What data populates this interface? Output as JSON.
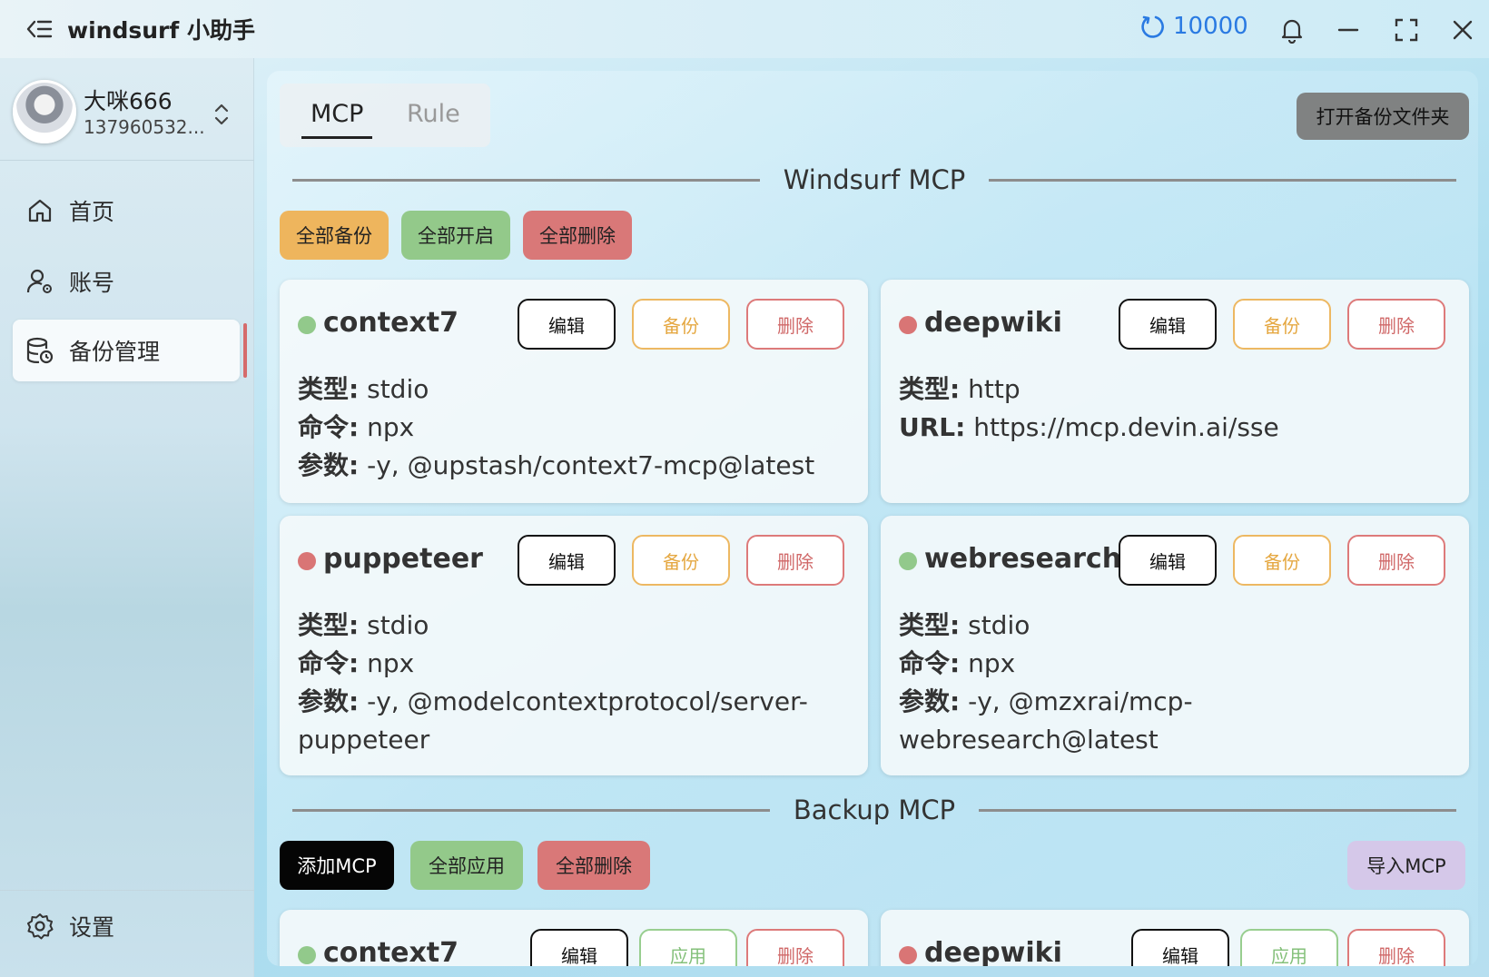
{
  "window": {
    "title": "windsurf 小助手",
    "credits": "10000"
  },
  "user": {
    "name": "大咪666",
    "id": "137960532..."
  },
  "sidebar": {
    "items": [
      {
        "label": "首页",
        "icon": "home-icon"
      },
      {
        "label": "账号",
        "icon": "user-gear-icon"
      },
      {
        "label": "备份管理",
        "icon": "database-backup-icon",
        "active": true
      }
    ],
    "settings_label": "设置"
  },
  "tabs": [
    "MCP",
    "Rule"
  ],
  "active_tab": "MCP",
  "open_backup_folder": "打开备份文件夹",
  "windsurf_section": {
    "title": "Windsurf MCP",
    "actions": [
      "全部备份",
      "全部开启",
      "全部删除"
    ],
    "cards": [
      {
        "name": "context7",
        "status": "green",
        "buttons": [
          "编辑",
          "备份",
          "删除"
        ],
        "lines": [
          {
            "label": "类型:",
            "value": "stdio"
          },
          {
            "label": "命令:",
            "value": "npx"
          },
          {
            "label": "参数:",
            "value": "-y, @upstash/context7-mcp@latest"
          }
        ]
      },
      {
        "name": "deepwiki",
        "status": "red",
        "buttons": [
          "编辑",
          "备份",
          "删除"
        ],
        "lines": [
          {
            "label": "类型:",
            "value": "http"
          },
          {
            "label": "URL:",
            "value": "https://mcp.devin.ai/sse"
          }
        ]
      },
      {
        "name": "puppeteer",
        "status": "red",
        "buttons": [
          "编辑",
          "备份",
          "删除"
        ],
        "lines": [
          {
            "label": "类型:",
            "value": "stdio"
          },
          {
            "label": "命令:",
            "value": "npx"
          },
          {
            "label": "参数:",
            "value": "-y, @modelcontextprotocol/server-puppeteer"
          }
        ]
      },
      {
        "name": "webresearch",
        "status": "green",
        "buttons": [
          "编辑",
          "备份",
          "删除"
        ],
        "lines": [
          {
            "label": "类型:",
            "value": "stdio"
          },
          {
            "label": "命令:",
            "value": "npx"
          },
          {
            "label": "参数:",
            "value": "-y, @mzxrai/mcp-webresearch@latest"
          }
        ]
      }
    ]
  },
  "backup_section": {
    "title": "Backup MCP",
    "actions": [
      "添加MCP",
      "全部应用",
      "全部删除"
    ],
    "import_label": "导入MCP",
    "cards": [
      {
        "name": "context7",
        "status": "green",
        "buttons": [
          "编辑",
          "应用",
          "删除"
        ]
      },
      {
        "name": "deepwiki",
        "status": "red",
        "buttons": [
          "编辑",
          "应用",
          "删除"
        ]
      }
    ]
  },
  "colors": {
    "status_green": "#92c98b",
    "status_red": "#d97575",
    "credits_blue": "#2a7ae2",
    "active_indicator": "#d56b6b"
  }
}
